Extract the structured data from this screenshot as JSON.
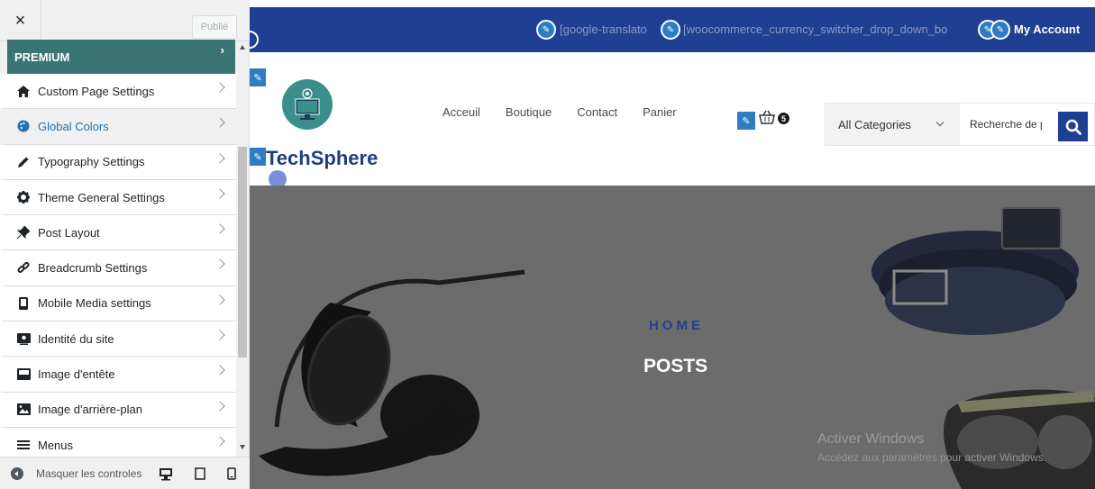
{
  "panel": {
    "close_label": "×",
    "publish_label": "Publié",
    "section_title": "PREMIUM",
    "items": [
      {
        "label": "Custom Page Settings",
        "icon": "home-icon"
      },
      {
        "label": "Global Colors",
        "icon": "palette-icon",
        "active": true
      },
      {
        "label": "Typography Settings",
        "icon": "pencil-icon"
      },
      {
        "label": "Theme General Settings",
        "icon": "gear-icon"
      },
      {
        "label": "Post Layout",
        "icon": "pin-icon"
      },
      {
        "label": "Breadcrumb Settings",
        "icon": "link-icon"
      },
      {
        "label": "Mobile Media settings",
        "icon": "tablet-icon"
      },
      {
        "label": "Identité du site",
        "icon": "id-card-icon"
      },
      {
        "label": "Image d'entête",
        "icon": "header-image-icon"
      },
      {
        "label": "Image d'arrière-plan",
        "icon": "background-image-icon"
      },
      {
        "label": "Menus",
        "icon": "menu-icon"
      }
    ],
    "footer": {
      "hide_label": "Masquer les controles"
    }
  },
  "preview": {
    "topbar": {
      "shortcode_translator": "[google-translato",
      "shortcode_currency": "[woocommerce_currency_switcher_drop_down_bo",
      "account_label": "My Account"
    },
    "site_title": "TechSphere",
    "nav": [
      "Acceuil",
      "Boutique",
      "Contact",
      "Panier"
    ],
    "cart_count": "5",
    "search": {
      "category": "All Categories",
      "placeholder": "Recherche de produits"
    },
    "hero": {
      "breadcrumb": "HOME",
      "title": "POSTS"
    },
    "watermark": {
      "title": "Activer Windows",
      "subtitle": "Accédez aux paramètres pour activer Windows."
    }
  },
  "colors": {
    "accent_teal": "#3a7572",
    "topbar_blue": "#1f3f93",
    "link_blue": "#2271b1",
    "edit_pencil": "#2e7cc4"
  }
}
